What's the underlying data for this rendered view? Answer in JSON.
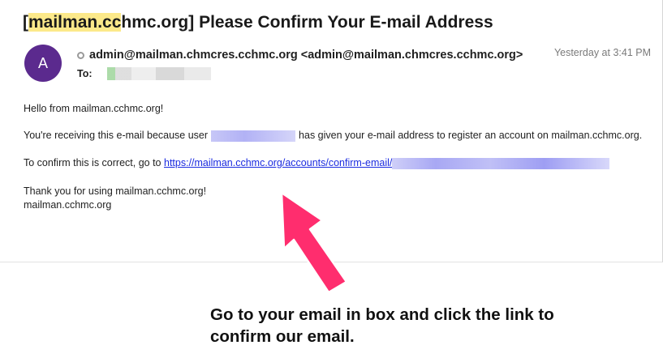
{
  "email": {
    "subject_tag": "mailman.cchmc.org",
    "subject_tag_highlight": "mailman.cc",
    "subject_tag_rest": "hmc.org",
    "subject_rest": " Please Confirm Your E-mail Address",
    "avatar_initial": "A",
    "from": "admin@mailman.chmcres.cchmc.org <admin@mailman.chmcres.cchmc.org>",
    "to_label": "To:",
    "timestamp": "Yesterday at 3:41 PM",
    "greeting": "Hello from mailman.cchmc.org!",
    "receiving_prefix": "You're receiving this e-mail because user",
    "receiving_suffix": "has given your e-mail address to register an account on mailman.cchmc.org.",
    "confirm_prefix": "To confirm this is correct, go to",
    "confirm_link": "https://mailman.cchmc.org/accounts/confirm-email/",
    "thanks": "Thank you for using mailman.cchmc.org!",
    "signature": "mailman.cchmc.org"
  },
  "annotation": {
    "instruction_line1": "Go to your email in box and click the link to",
    "instruction_line2": "confirm our email.",
    "arrow_color": "#ff2d6e"
  },
  "colors": {
    "avatar_bg": "#5b2a8e",
    "highlight": "#fce98a",
    "link": "#1b2be0"
  }
}
